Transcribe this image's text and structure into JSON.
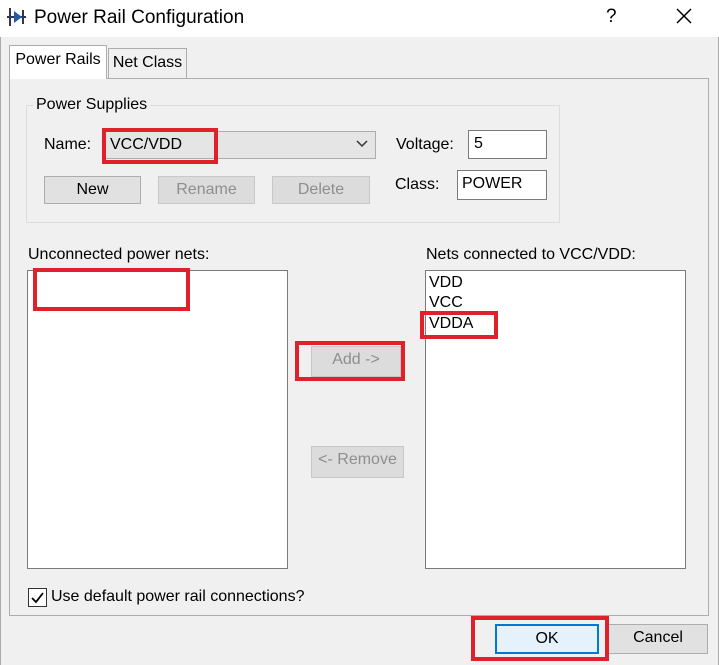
{
  "window": {
    "title": "Power Rail Configuration",
    "help_label": "?"
  },
  "tabs": [
    {
      "label": "Power Rails"
    },
    {
      "label": "Net Class"
    }
  ],
  "power_supplies": {
    "group_title": "Power Supplies",
    "name_label": "Name:",
    "name_value": "VCC/VDD",
    "voltage_label": "Voltage:",
    "voltage_value": "5",
    "class_label": "Class:",
    "class_value": "POWER",
    "buttons": {
      "new": "New",
      "rename": "Rename",
      "delete": "Delete"
    }
  },
  "unconnected": {
    "label": "Unconnected power nets:",
    "items": []
  },
  "connected": {
    "label": "Nets connected to VCC/VDD:",
    "items": [
      "VDD",
      "VCC",
      "VDDA"
    ]
  },
  "transfer": {
    "add": "Add ->",
    "remove": "<- Remove"
  },
  "default_connections": {
    "label": "Use default power rail connections?",
    "checked": true
  },
  "footer": {
    "ok": "OK",
    "cancel": "Cancel"
  },
  "colors": {
    "highlight": "#e0202a",
    "accent": "#0078d7",
    "dialog_bg": "#f0f0f0"
  }
}
